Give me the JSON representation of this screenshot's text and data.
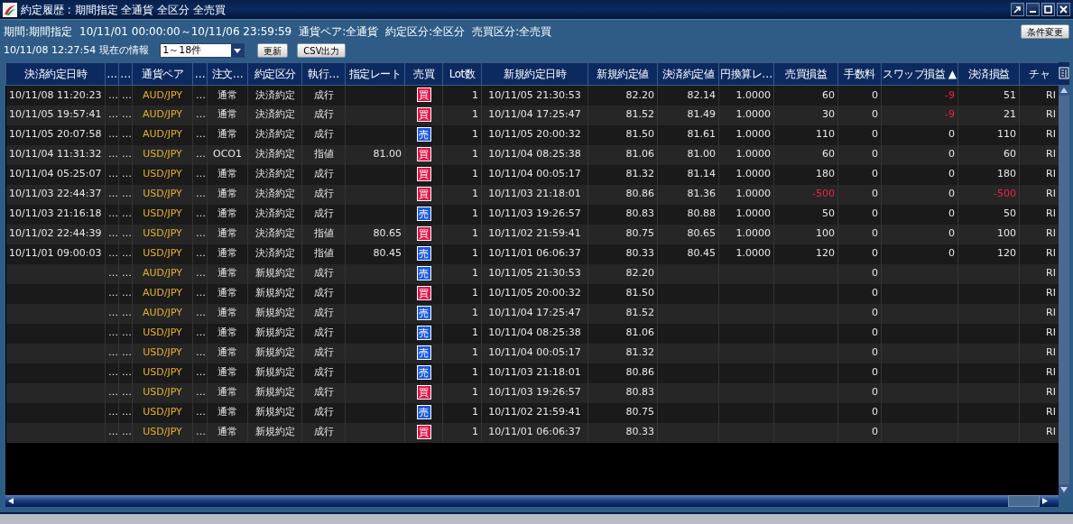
{
  "window": {
    "title": "約定履歴 : 期間指定 全通貨 全区分 全売買"
  },
  "conditions": [
    "期間:期間指定",
    "10/11/01 00:00:00～10/11/06 23:59:59",
    "通貨ペア:全通貨",
    "約定区分:全区分",
    "売買区分:全売買"
  ],
  "change_button": "条件変更",
  "status": {
    "timestamp": "10/11/08 12:27:54",
    "label": "現在の情報"
  },
  "range_select": {
    "value": "1～18件"
  },
  "buttons": [
    "更新",
    "CSV出力"
  ],
  "table": {
    "columns": [
      "決済約定日時",
      "…",
      "…",
      "通貨ペア",
      "…",
      "注文…",
      "約定区分",
      "執行…",
      "指定レート",
      "売買",
      "Lot数",
      "新規約定日時",
      "新規約定値",
      "決済約定値",
      "円換算レ…",
      "売買損益",
      "手数料",
      "スワップ損益 ▲",
      "決済損益",
      "チャ"
    ],
    "rows": [
      [
        "10/11/08 11:20:23",
        "…",
        "…",
        "AUD/JPY",
        "…",
        "通常",
        "決済約定",
        "成行",
        null,
        {
          "kind": "buy",
          "text": "買"
        },
        "1",
        "10/11/05 21:30:53",
        "82.20",
        "82.14",
        "1.0000",
        "60",
        "0",
        {
          "kind": "loss",
          "text": "-9"
        },
        "51",
        "RI"
      ],
      [
        "10/11/05 19:57:41",
        "…",
        "…",
        "AUD/JPY",
        "…",
        "通常",
        "決済約定",
        "成行",
        null,
        {
          "kind": "buy",
          "text": "買"
        },
        "1",
        "10/11/04 17:25:47",
        "81.52",
        "81.49",
        "1.0000",
        "30",
        "0",
        {
          "kind": "loss",
          "text": "-9"
        },
        "21",
        "RI"
      ],
      [
        "10/11/05 20:07:58",
        "…",
        "…",
        "AUD/JPY",
        "…",
        "通常",
        "決済約定",
        "成行",
        null,
        {
          "kind": "sell",
          "text": "売"
        },
        "1",
        "10/11/05 20:00:32",
        "81.50",
        "81.61",
        "1.0000",
        "110",
        "0",
        "0",
        "110",
        "RI"
      ],
      [
        "10/11/04 11:31:32",
        "…",
        "…",
        "USD/JPY",
        "…",
        "OCO1",
        "決済約定",
        "指値",
        "81.00",
        {
          "kind": "buy",
          "text": "買"
        },
        "1",
        "10/11/04 08:25:38",
        "81.06",
        "81.00",
        "1.0000",
        "60",
        "0",
        "0",
        "60",
        "RI"
      ],
      [
        "10/11/04 05:25:07",
        "…",
        "…",
        "USD/JPY",
        "…",
        "通常",
        "決済約定",
        "成行",
        null,
        {
          "kind": "buy",
          "text": "買"
        },
        "1",
        "10/11/04 00:05:17",
        "81.32",
        "81.14",
        "1.0000",
        "180",
        "0",
        "0",
        "180",
        "RI"
      ],
      [
        "10/11/03 22:44:37",
        "…",
        "…",
        "USD/JPY",
        "…",
        "通常",
        "決済約定",
        "成行",
        null,
        {
          "kind": "buy",
          "text": "買"
        },
        "1",
        "10/11/03 21:18:01",
        "80.86",
        "81.36",
        "1.0000",
        {
          "kind": "loss",
          "text": "-500"
        },
        "0",
        "0",
        {
          "kind": "loss",
          "text": "-500"
        },
        "RI"
      ],
      [
        "10/11/03 21:16:18",
        "…",
        "…",
        "USD/JPY",
        "…",
        "通常",
        "決済約定",
        "成行",
        null,
        {
          "kind": "sell",
          "text": "売"
        },
        "1",
        "10/11/03 19:26:57",
        "80.83",
        "80.88",
        "1.0000",
        "50",
        "0",
        "0",
        "50",
        "RI"
      ],
      [
        "10/11/02 22:44:39",
        "…",
        "…",
        "USD/JPY",
        "…",
        "通常",
        "決済約定",
        "指値",
        "80.65",
        {
          "kind": "buy",
          "text": "買"
        },
        "1",
        "10/11/02 21:59:41",
        "80.75",
        "80.65",
        "1.0000",
        "100",
        "0",
        "0",
        "100",
        "RI"
      ],
      [
        "10/11/01 09:00:03",
        "…",
        "…",
        "USD/JPY",
        "…",
        "通常",
        "決済約定",
        "指値",
        "80.45",
        {
          "kind": "sell",
          "text": "売"
        },
        "1",
        "10/11/01 06:06:37",
        "80.33",
        "80.45",
        "1.0000",
        "120",
        "0",
        "0",
        "120",
        "RI"
      ],
      [
        null,
        "…",
        "…",
        "AUD/JPY",
        "…",
        "通常",
        "新規約定",
        "成行",
        null,
        {
          "kind": "sell",
          "text": "売"
        },
        "1",
        "10/11/05 21:30:53",
        "82.20",
        null,
        null,
        null,
        "0",
        null,
        null,
        "RI"
      ],
      [
        null,
        "…",
        "…",
        "AUD/JPY",
        "…",
        "通常",
        "新規約定",
        "成行",
        null,
        {
          "kind": "buy",
          "text": "買"
        },
        "1",
        "10/11/05 20:00:32",
        "81.50",
        null,
        null,
        null,
        "0",
        null,
        null,
        "RI"
      ],
      [
        null,
        "…",
        "…",
        "AUD/JPY",
        "…",
        "通常",
        "新規約定",
        "成行",
        null,
        {
          "kind": "sell",
          "text": "売"
        },
        "1",
        "10/11/04 17:25:47",
        "81.52",
        null,
        null,
        null,
        "0",
        null,
        null,
        "RI"
      ],
      [
        null,
        "…",
        "…",
        "USD/JPY",
        "…",
        "通常",
        "新規約定",
        "成行",
        null,
        {
          "kind": "sell",
          "text": "売"
        },
        "1",
        "10/11/04 08:25:38",
        "81.06",
        null,
        null,
        null,
        "0",
        null,
        null,
        "RI"
      ],
      [
        null,
        "…",
        "…",
        "USD/JPY",
        "…",
        "通常",
        "新規約定",
        "成行",
        null,
        {
          "kind": "sell",
          "text": "売"
        },
        "1",
        "10/11/04 00:05:17",
        "81.32",
        null,
        null,
        null,
        "0",
        null,
        null,
        "RI"
      ],
      [
        null,
        "…",
        "…",
        "USD/JPY",
        "…",
        "通常",
        "新規約定",
        "成行",
        null,
        {
          "kind": "sell",
          "text": "売"
        },
        "1",
        "10/11/03 21:18:01",
        "80.86",
        null,
        null,
        null,
        "0",
        null,
        null,
        "RI"
      ],
      [
        null,
        "…",
        "…",
        "USD/JPY",
        "…",
        "通常",
        "新規約定",
        "成行",
        null,
        {
          "kind": "buy",
          "text": "買"
        },
        "1",
        "10/11/03 19:26:57",
        "80.83",
        null,
        null,
        null,
        "0",
        null,
        null,
        "RI"
      ],
      [
        null,
        "…",
        "…",
        "USD/JPY",
        "…",
        "通常",
        "新規約定",
        "成行",
        null,
        {
          "kind": "sell",
          "text": "売"
        },
        "1",
        "10/11/02 21:59:41",
        "80.75",
        null,
        null,
        null,
        "0",
        null,
        null,
        "RI"
      ],
      [
        null,
        "…",
        "…",
        "USD/JPY",
        "…",
        "通常",
        "新規約定",
        "成行",
        null,
        {
          "kind": "buy",
          "text": "買"
        },
        "1",
        "10/11/01 06:06:37",
        "80.33",
        null,
        null,
        null,
        "0",
        null,
        null,
        "RI"
      ]
    ]
  }
}
